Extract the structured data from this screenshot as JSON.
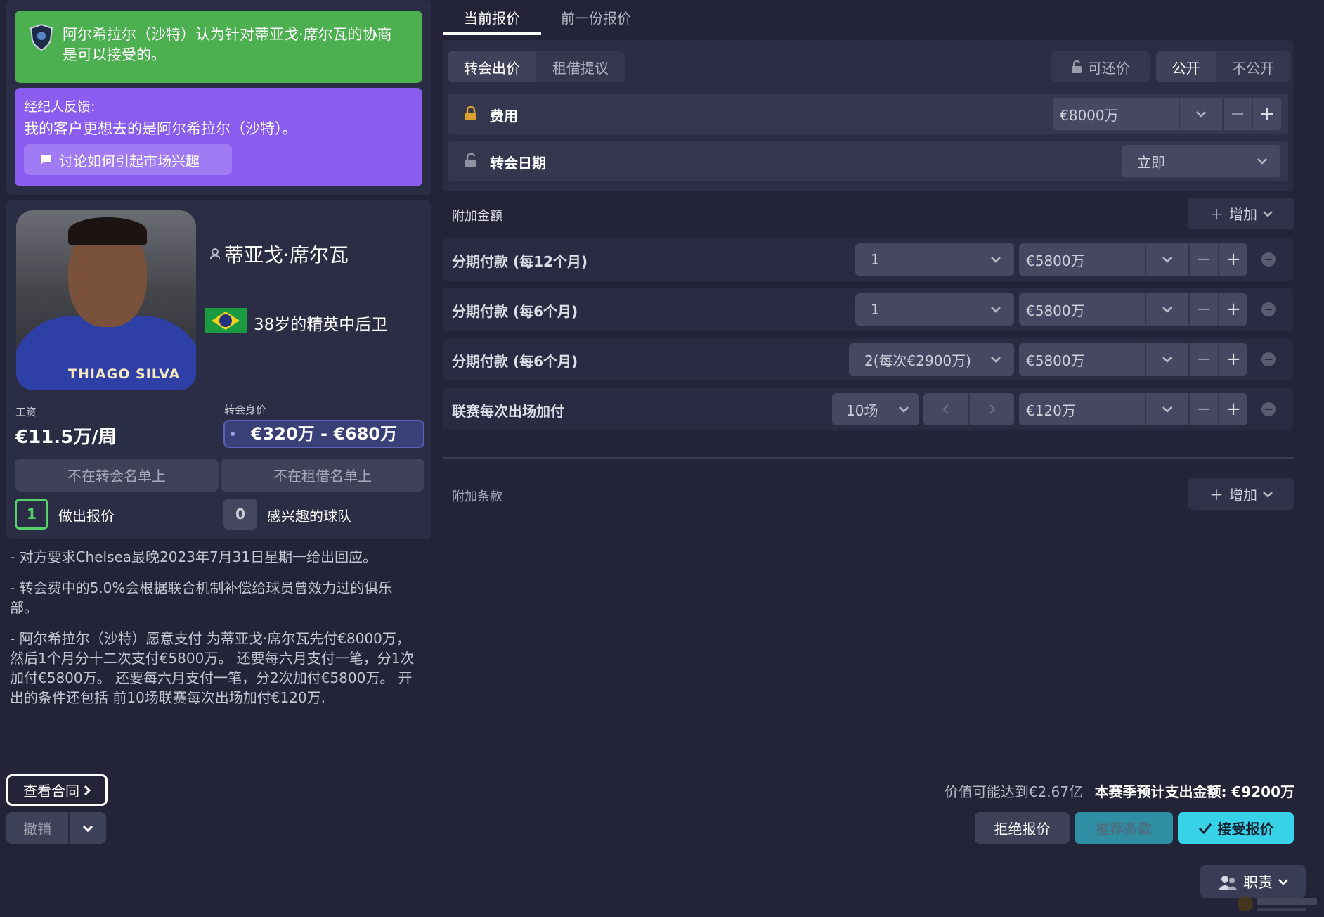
{
  "messages": {
    "club_accept": "阿尔希拉尔（沙特）认为针对蒂亚戈·席尔瓦的协商是可以接受的。",
    "agent_label": "经纪人反馈:",
    "agent_feedback": "我的客户更想去的是阿尔希拉尔（沙特）。",
    "discuss_button": "讨论如何引起市场兴趣"
  },
  "player": {
    "name": "蒂亚戈·席尔瓦",
    "description": "38岁的精英中后卫",
    "shirt_text": "THIAGO SILVA",
    "wage_label": "工资",
    "wage": "€11.5万/周",
    "transfer_value_label": "转会身价",
    "transfer_value": "€320万 - €680万",
    "not_transfer_listed": "不在转会名单上",
    "not_loan_listed": "不在租借名单上",
    "offers_count": "1",
    "offers_label": "做出报价",
    "interested_count": "0",
    "interested_label": "感兴趣的球队"
  },
  "notes": [
    "- 对方要求Chelsea最晚2023年7月31日星期一给出回应。",
    "- 转会费中的5.0%会根据联合机制补偿给球员曾效力过的俱乐部。",
    "- 阿尔希拉尔（沙特）愿意支付 为蒂亚戈·席尔瓦先付€8000万，然后1个月分十二次支付€5800万。 还要每六月支付一笔，分1次加付€5800万。 还要每六月支付一笔，分2次加付€5800万。 开出的条件还包括 前10场联赛每次出场加付€120万."
  ],
  "left_actions": {
    "view_contract": "查看合同",
    "withdraw": "撤销"
  },
  "tabs": {
    "current": "当前报价",
    "previous": "前一份报价"
  },
  "offer": {
    "transfer_offer": "转会出价",
    "loan_offer": "租借提议",
    "negotiable": "可还价",
    "public": "公开",
    "private": "不公开",
    "fee_label": "费用",
    "fee_value": "€8000万",
    "date_label": "转会日期",
    "date_value": "立即"
  },
  "add_ons": {
    "label": "附加金额",
    "add_button": "增加",
    "rows": [
      {
        "label": "分期付款 (每12个月)",
        "count": "1",
        "amount": "€5800万"
      },
      {
        "label": "分期付款 (每6个月)",
        "count": "1",
        "amount": "€5800万"
      },
      {
        "label": "分期付款 (每6个月)",
        "count": "2(每次€2900万)",
        "amount": "€5800万"
      },
      {
        "label": "联赛每次出场加付",
        "count": "10场",
        "amount": "€120万"
      }
    ]
  },
  "clauses": {
    "label": "附加条款",
    "add_button": "增加"
  },
  "summary": {
    "potential": "价值可能达到€2.67亿",
    "season_spend": "本赛季预计支出金额: €9200万"
  },
  "actions": {
    "reject": "拒绝报价",
    "recommend": "推荐条款",
    "accept": "接受报价",
    "duty": "职责"
  },
  "colors": {
    "background": "#232438",
    "panel": "#2b2d44",
    "green": "#4caf50",
    "purple": "#8a5cf0",
    "accent_cyan": "#37d2e8"
  }
}
